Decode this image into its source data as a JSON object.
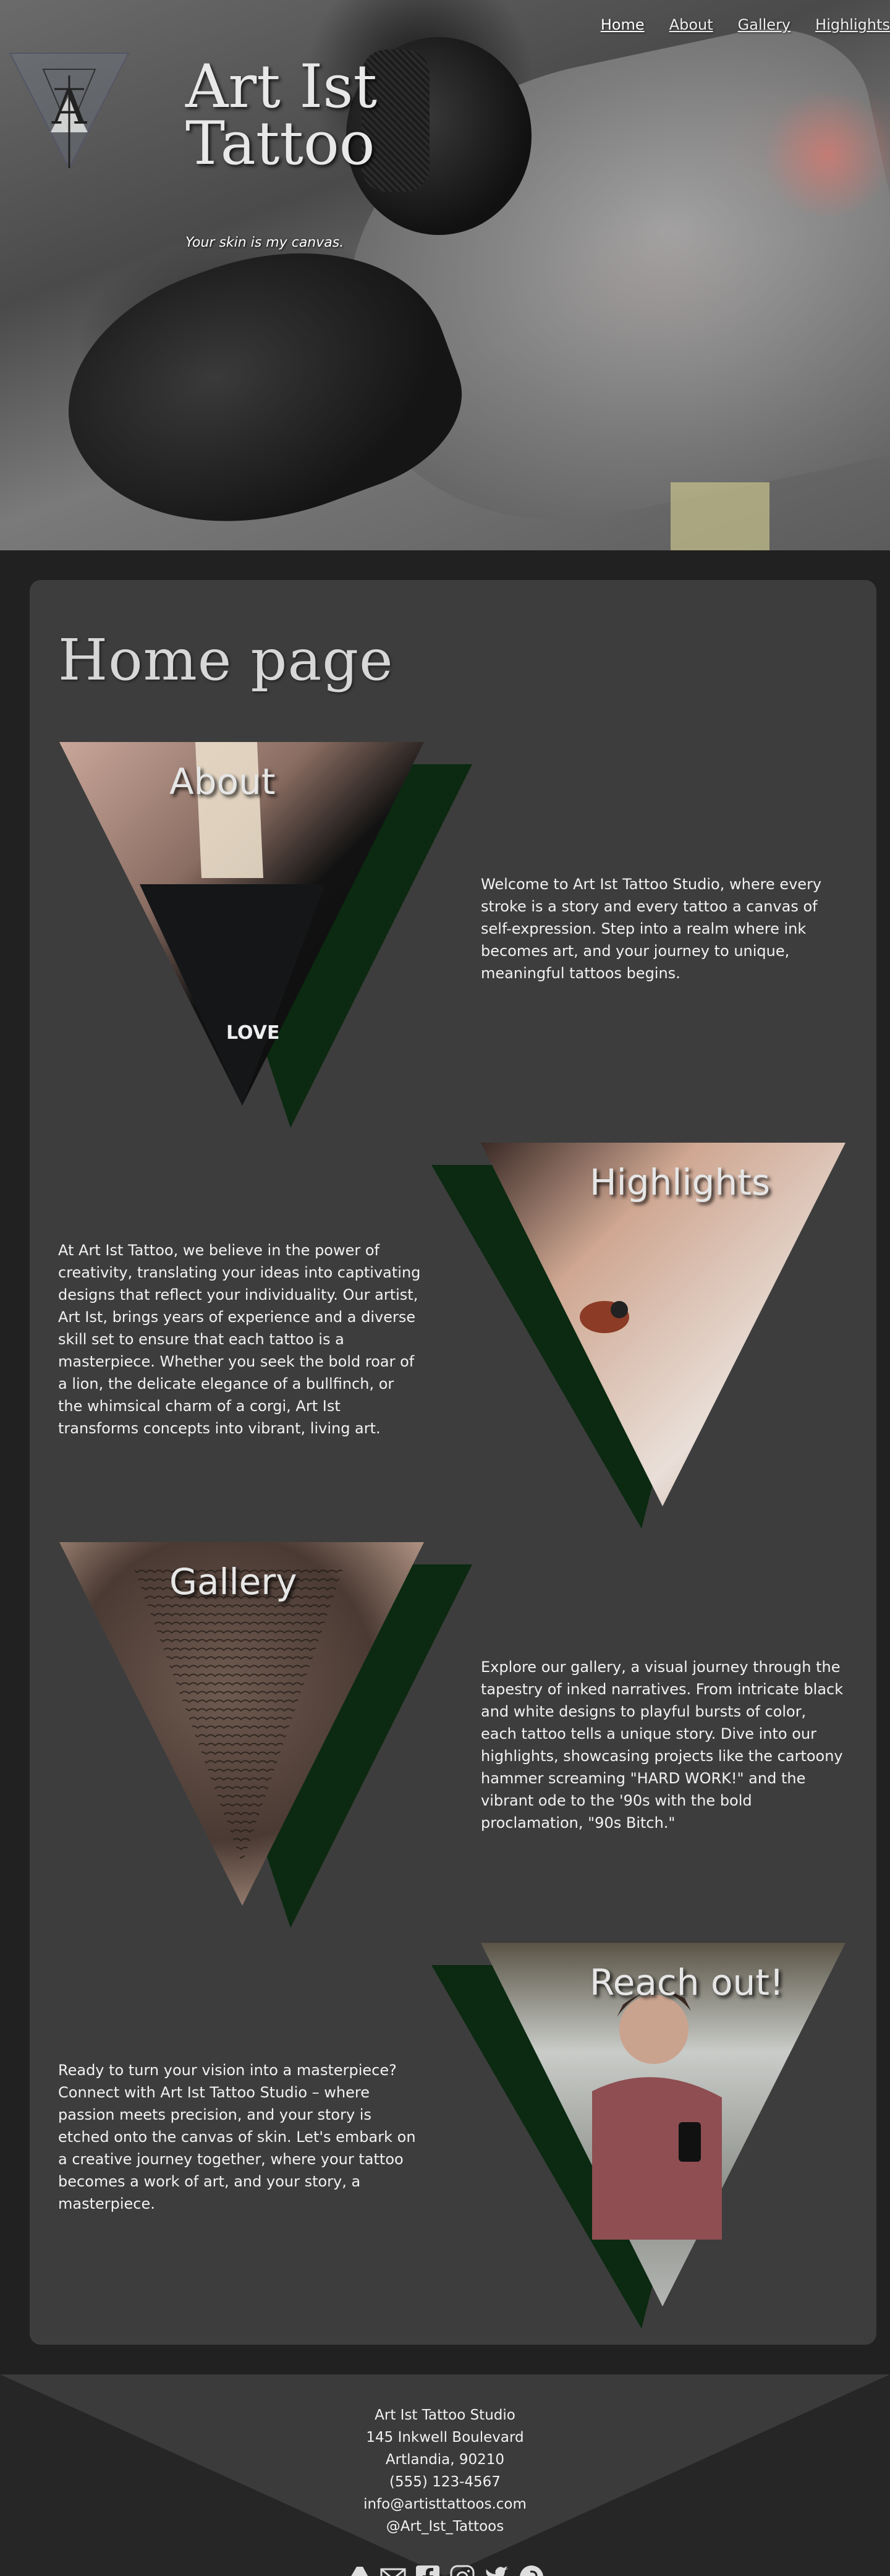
{
  "hero": {
    "title_line1": "Art Ist",
    "title_line2": "Tattoo",
    "tagline": "Your skin is my canvas.",
    "logo_letters": "AT"
  },
  "nav": {
    "items": [
      {
        "label": "Home",
        "active": true
      },
      {
        "label": "About",
        "active": false
      },
      {
        "label": "Gallery",
        "active": false
      },
      {
        "label": "Highlights",
        "active": false
      }
    ]
  },
  "main": {
    "page_title": "Home page",
    "sections": [
      {
        "title": "About",
        "text": "Welcome to Art Ist Tattoo Studio, where every stroke is a story and every tattoo a canvas of self-expression. Step into a realm where ink becomes art, and your journey to unique, meaningful tattoos begins."
      },
      {
        "title": "Highlights",
        "text": "At Art Ist Tattoo, we believe in the power of creativity, translating your ideas into captivating designs that reflect your individuality. Our artist, Art Ist, brings years of experience and a diverse skill set to ensure that each tattoo is a masterpiece. Whether you seek the bold roar of a lion, the delicate elegance of a bullfinch, or the whimsical charm of a corgi, Art Ist transforms concepts into vibrant, living art."
      },
      {
        "title": "Gallery",
        "text": "Explore our gallery, a visual journey through the tapestry of inked narratives. From intricate black and white designs to playful bursts of color, each tattoo tells a unique story. Dive into our highlights, showcasing projects like the cartoony hammer screaming \"HARD WORK!\" and the vibrant ode to the '90s with the bold proclamation, \"90s Bitch.\""
      },
      {
        "title": "Reach out!",
        "text": "Ready to turn your vision into a masterpiece? Connect with Art Ist Tattoo Studio – where passion meets precision, and your story is etched onto the canvas of skin. Let's embark on a creative journey together, where your tattoo becomes a work of art, and your story, a masterpiece."
      }
    ]
  },
  "footer": {
    "studio": "Art Ist Tattoo Studio",
    "street": "145 Inkwell Boulevard",
    "city": "Artlandia, 90210",
    "phone": "(555) 123-4567",
    "email": "info@artisttattoos.com",
    "handle": "@Art_Ist_Tattoos",
    "socials": [
      "artstation-icon",
      "mail-icon",
      "facebook-icon",
      "instagram-icon",
      "twitter-icon",
      "pinterest-icon"
    ]
  },
  "colors": {
    "accent_green": "#0c2a12",
    "card_bg": "#3d3d3d",
    "page_bg": "#212121"
  }
}
